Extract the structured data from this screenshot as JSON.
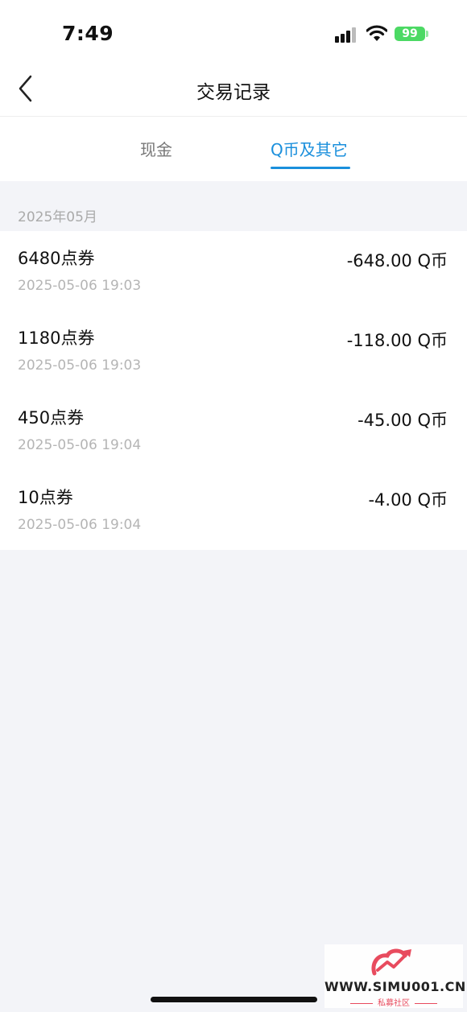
{
  "status": {
    "time": "7:49",
    "battery": "99"
  },
  "nav": {
    "title": "交易记录"
  },
  "tabs": [
    {
      "label": "现金",
      "active": false
    },
    {
      "label": "Q币及其它",
      "active": true
    }
  ],
  "month": "2025年05月",
  "transactions": [
    {
      "title": "6480点券",
      "time": "2025-05-06 19:03",
      "amount": "-648.00 Q币"
    },
    {
      "title": "1180点券",
      "time": "2025-05-06 19:03",
      "amount": "-118.00 Q币"
    },
    {
      "title": "450点券",
      "time": "2025-05-06 19:04",
      "amount": "-45.00 Q币"
    },
    {
      "title": "10点券",
      "time": "2025-05-06 19:04",
      "amount": "-4.00 Q币"
    }
  ],
  "watermark": {
    "url": "WWW.SIMU001.CN",
    "name": "私募社区"
  },
  "colors": {
    "accent": "#1a8fdc",
    "battery": "#4cd964",
    "background": "#f3f4f8"
  }
}
